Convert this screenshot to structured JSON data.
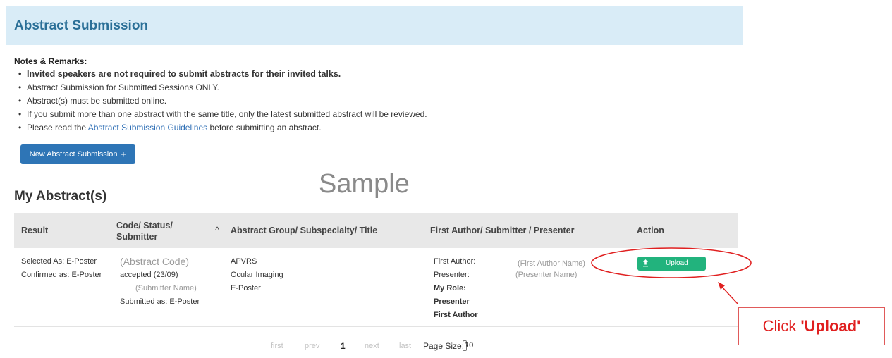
{
  "header": {
    "title": "Abstract Submission"
  },
  "notes": {
    "heading": "Notes & Remarks:",
    "items": [
      "Invited speakers are not required to submit abstracts for their invited talks.",
      "Abstract Submission for Submitted Sessions ONLY.",
      "Abstract(s) must be submitted online.",
      "If you submit more than one abstract with the same title, only the latest submitted abstract will be reviewed."
    ],
    "last_prefix": "Please read the",
    "last_link": "Abstract Submission Guidelines",
    "last_suffix": "before submitting an abstract."
  },
  "new_button": {
    "label": "New Abstract Submission",
    "icon": "plus-icon",
    "plus": "+"
  },
  "watermark": "Sample",
  "section_title": "My Abstract(s)",
  "table": {
    "headers": {
      "result": "Result",
      "code_line1": "Code/ Status/",
      "code_line2": "Submitter",
      "sort": "^",
      "group": "Abstract Group/ Subspecialty/ Title",
      "author": "First Author/ Submitter / Presenter",
      "action": "Action"
    },
    "row": {
      "result": [
        "Selected As: E-Poster",
        "Confirmed as: E-Poster"
      ],
      "code": "(Abstract Code)",
      "status": "accepted (23/09)",
      "submitter": "(Submitter Name)",
      "submitted_as": "Submitted as: E-Poster",
      "group": [
        "APVRS",
        "Ocular Imaging",
        "E-Poster"
      ],
      "first_author_label": "First Author:",
      "presenter_label": "Presenter:",
      "my_role_label": "My Role:",
      "role_presenter": "Presenter",
      "role_first_author": "First Author",
      "first_author_name": "(First Author Name)",
      "presenter_name": "(Presenter Name)",
      "upload_label": "Upload",
      "upload_icon": "upload-icon"
    }
  },
  "callout": {
    "prefix": "Click",
    "emphasis": "'Upload'"
  },
  "pager": {
    "first": "first",
    "prev": "prev",
    "current": "1",
    "next": "next",
    "last": "last",
    "page_size_label": "Page Size:",
    "page_size_value": "10"
  },
  "colors": {
    "header_bg": "#d9ecf7",
    "title": "#2a6f97",
    "primary_button": "#2e75b6",
    "upload_button": "#22b37d",
    "annotation_red": "#e02020"
  }
}
